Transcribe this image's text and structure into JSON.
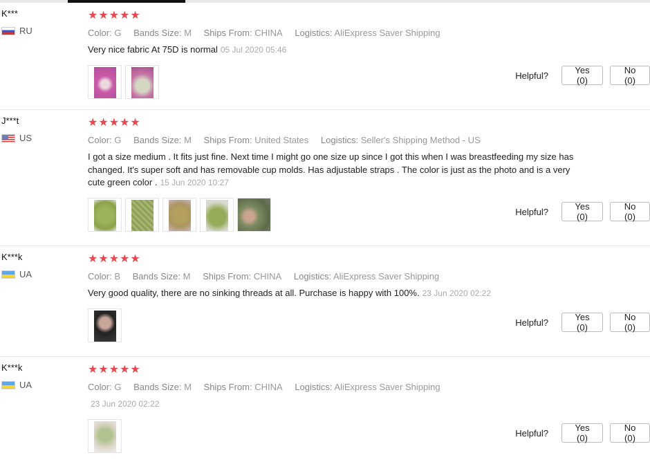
{
  "labels": {
    "color": "Color:",
    "bands_size": "Bands Size:",
    "ships_from": "Ships From:",
    "logistics": "Logistics:",
    "helpful": "Helpful?",
    "stars": "★★★★★"
  },
  "colors": {
    "star": "#e8484f",
    "tab_active": "#111111"
  },
  "reviews": [
    {
      "buyer": "K***",
      "country": "RU",
      "rating": 5,
      "color": "G",
      "bands_size": "M",
      "ships_from": "CHINA",
      "logistics": "AliExpress Saver Shipping",
      "text": "Very nice fabric At 75D is normal",
      "date": "05 Jul 2020 05:46",
      "yes": "Yes (0)",
      "no": "No (0)",
      "photo_count": 2
    },
    {
      "buyer": "J***t",
      "country": "US",
      "rating": 5,
      "color": "G",
      "bands_size": "M",
      "ships_from": "United States",
      "logistics": "Seller's Shipping Method - US",
      "text": "I got a size medium . It fits just fine. Next time I might go one size up since I got this when I was breastfeeding my size has changed. It's super soft and has removable cup molds. Has adjustable straps . The color is just as the photo and is a very cute green color .",
      "date": "15 Jun 2020 10:27",
      "yes": "Yes (0)",
      "no": "No (0)",
      "photo_count": 5
    },
    {
      "buyer": "K***k",
      "country": "UA",
      "rating": 5,
      "color": "B",
      "bands_size": "M",
      "ships_from": "CHINA",
      "logistics": "AliExpress Saver Shipping",
      "text": "Very good quality, there are no sinking threads at all. Purchase is happy with 100%.",
      "date": "23 Jun 2020 02:22",
      "yes": "Yes (0)",
      "no": "No (0)",
      "photo_count": 1
    },
    {
      "buyer": "K***k",
      "country": "UA",
      "rating": 5,
      "color": "G",
      "bands_size": "M",
      "ships_from": "CHINA",
      "logistics": "AliExpress Saver Shipping",
      "text": "",
      "date": "23 Jun 2020 02:22",
      "yes": "Yes (0)",
      "no": "No (0)",
      "photo_count": 1
    }
  ]
}
